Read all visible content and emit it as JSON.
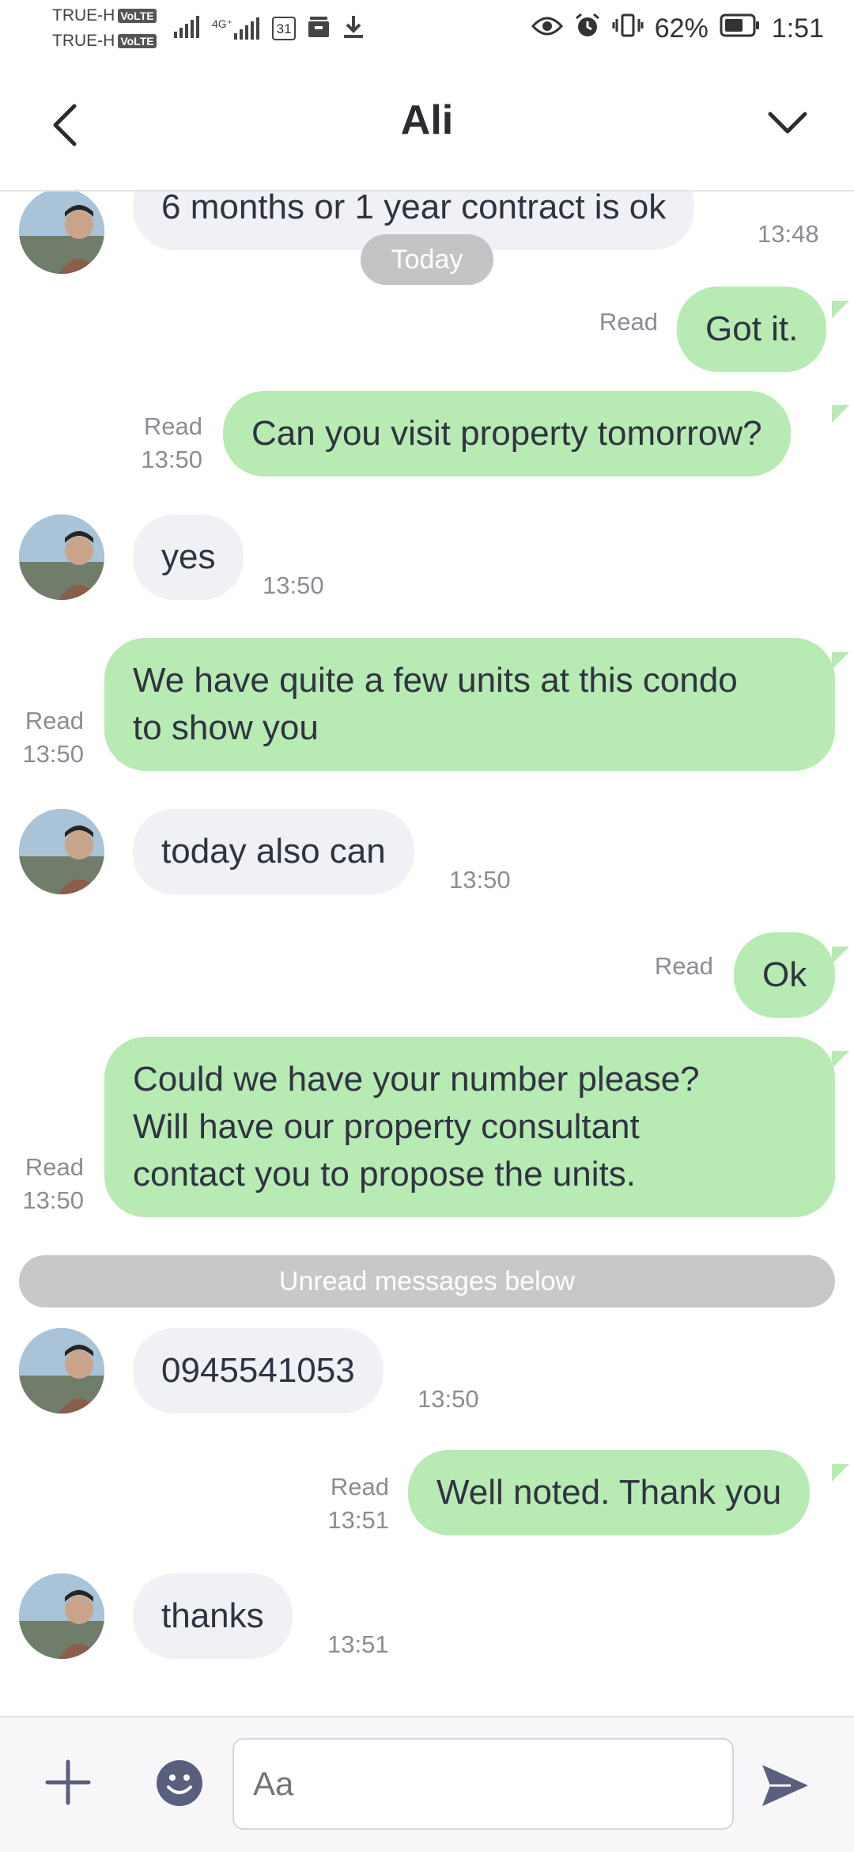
{
  "status_bar": {
    "carrier_1": "TRUE-H",
    "carrier_2": "TRUE-H",
    "volte": "VoLTE",
    "network": "4G⁺",
    "calendar_day": "31",
    "battery": "62%",
    "time": "1:51"
  },
  "header": {
    "title": "Ali"
  },
  "separators": {
    "today": "Today",
    "unread": "Unread messages below"
  },
  "messages": [
    {
      "dir": "in",
      "text": "6 months or 1 year contract is ok",
      "time": "13:48"
    },
    {
      "dir": "out",
      "text": "Got it.",
      "read": "Read",
      "time": ""
    },
    {
      "dir": "out",
      "text": "Can you visit property tomorrow?",
      "read": "Read",
      "time": "13:50"
    },
    {
      "dir": "in",
      "text": "yes",
      "time": "13:50"
    },
    {
      "dir": "out",
      "text": [
        "We have quite a few units at this condo",
        "to show you"
      ],
      "read": "Read",
      "time": "13:50"
    },
    {
      "dir": "in",
      "text": "today also can",
      "time": "13:50"
    },
    {
      "dir": "out",
      "text": "Ok",
      "read": "Read",
      "time": ""
    },
    {
      "dir": "out",
      "text": [
        "Could we have your number please?",
        "Will have our property consultant",
        "contact you to propose the units."
      ],
      "read": "Read",
      "time": "13:50"
    },
    {
      "dir": "in",
      "text": "0945541053",
      "time": "13:50"
    },
    {
      "dir": "out",
      "text": "Well noted. Thank you",
      "read": "Read",
      "time": "13:51"
    },
    {
      "dir": "in",
      "text": "thanks",
      "time": "13:51"
    }
  ],
  "composer": {
    "placeholder": "Aa"
  },
  "icons": {
    "back": "chevron-left-icon",
    "collapse": "chevron-down-icon",
    "add": "plus-icon",
    "emoji": "emoji-icon",
    "send": "send-icon"
  },
  "colors": {
    "outgoing_bubble": "#b8eab3",
    "incoming_bubble": "#f0f1f5",
    "pill": "#c4c4c6",
    "icon": "#5a5f7d"
  }
}
